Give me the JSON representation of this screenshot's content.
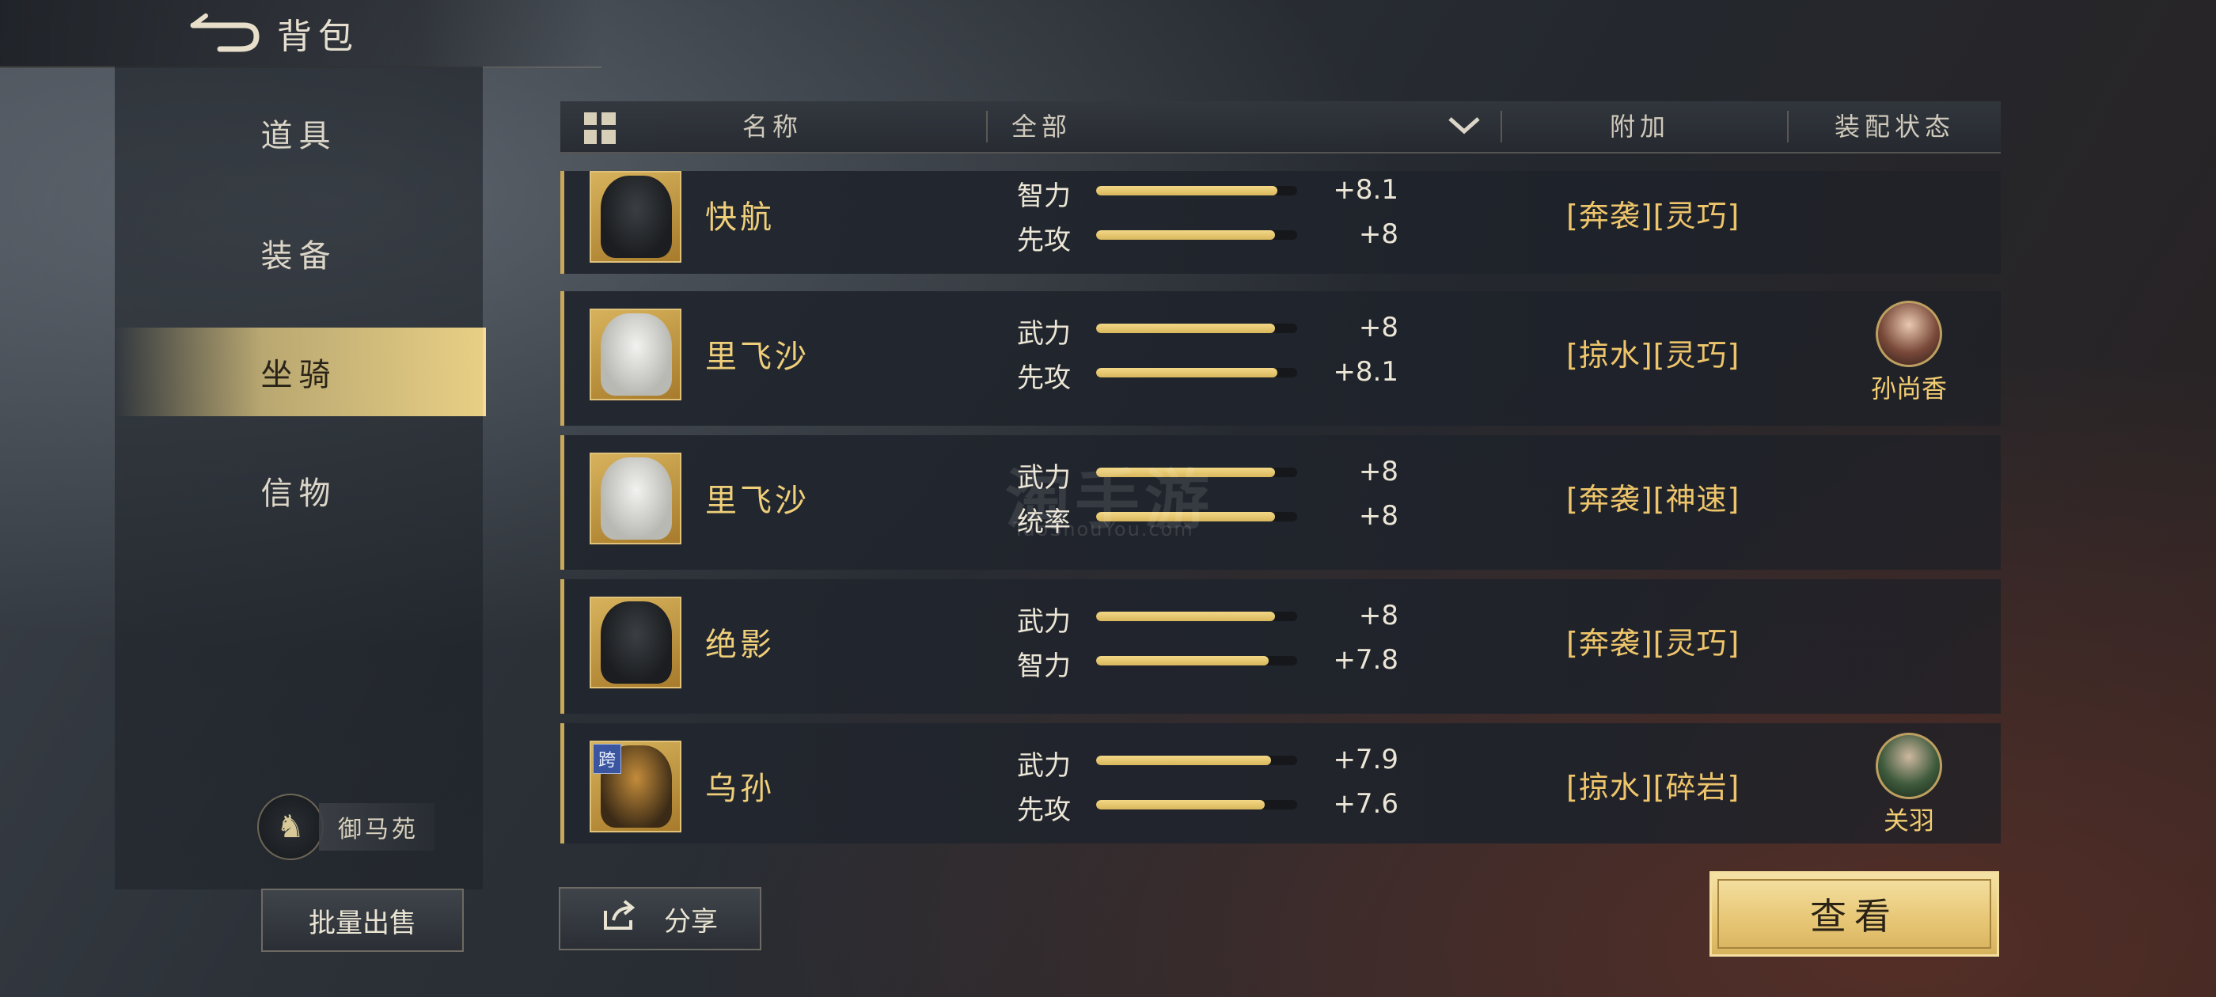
{
  "header": {
    "title": "背包"
  },
  "sidebar": {
    "items": [
      {
        "label": "道具",
        "active": false
      },
      {
        "label": "装备",
        "active": false
      },
      {
        "label": "坐骑",
        "active": true
      },
      {
        "label": "信物",
        "active": false
      }
    ],
    "stable_label": "御马苑",
    "bulk_sell_label": "批量出售"
  },
  "table": {
    "headers": {
      "name": "名称",
      "filter": "全部",
      "bonus": "附加",
      "status": "装配状态"
    },
    "rows": [
      {
        "name": "快航",
        "stats": [
          {
            "label": "智力",
            "value": "+8.1",
            "fill": 0.9
          },
          {
            "label": "先攻",
            "value": "+8",
            "fill": 0.89
          }
        ],
        "traits": "[奔袭][灵巧]",
        "equipped_by": "",
        "portrait": "",
        "thumb": "dark-horse",
        "cross_tag": ""
      },
      {
        "name": "里飞沙",
        "stats": [
          {
            "label": "武力",
            "value": "+8",
            "fill": 0.89
          },
          {
            "label": "先攻",
            "value": "+8.1",
            "fill": 0.9
          }
        ],
        "traits": "[掠水][灵巧]",
        "equipped_by": "孙尚香",
        "portrait": "female-hero",
        "thumb": "white-horse",
        "cross_tag": ""
      },
      {
        "name": "里飞沙",
        "stats": [
          {
            "label": "武力",
            "value": "+8",
            "fill": 0.89
          },
          {
            "label": "统率",
            "value": "+8",
            "fill": 0.89
          }
        ],
        "traits": "[奔袭][神速]",
        "equipped_by": "",
        "portrait": "",
        "thumb": "white-horse",
        "cross_tag": ""
      },
      {
        "name": "绝影",
        "stats": [
          {
            "label": "武力",
            "value": "+8",
            "fill": 0.89
          },
          {
            "label": "智力",
            "value": "+7.8",
            "fill": 0.86
          }
        ],
        "traits": "[奔袭][灵巧]",
        "equipped_by": "",
        "portrait": "",
        "thumb": "dark-horse",
        "cross_tag": ""
      },
      {
        "name": "乌孙",
        "stats": [
          {
            "label": "武力",
            "value": "+7.9",
            "fill": 0.87
          },
          {
            "label": "先攻",
            "value": "+7.6",
            "fill": 0.84
          }
        ],
        "traits": "[掠水][碎岩]",
        "equipped_by": "关羽",
        "portrait": "male-hero",
        "thumb": "dark-horse",
        "cross_tag": "跨"
      }
    ]
  },
  "watermark": {
    "main": "淘手游",
    "sub": "TaoShouYou.com"
  },
  "actions": {
    "share_label": "分享",
    "view_label": "查看"
  },
  "colors": {
    "accent_gold": "#e8cf85",
    "trait_gold": "#eec56a",
    "name_gold": "#efcf7a"
  }
}
